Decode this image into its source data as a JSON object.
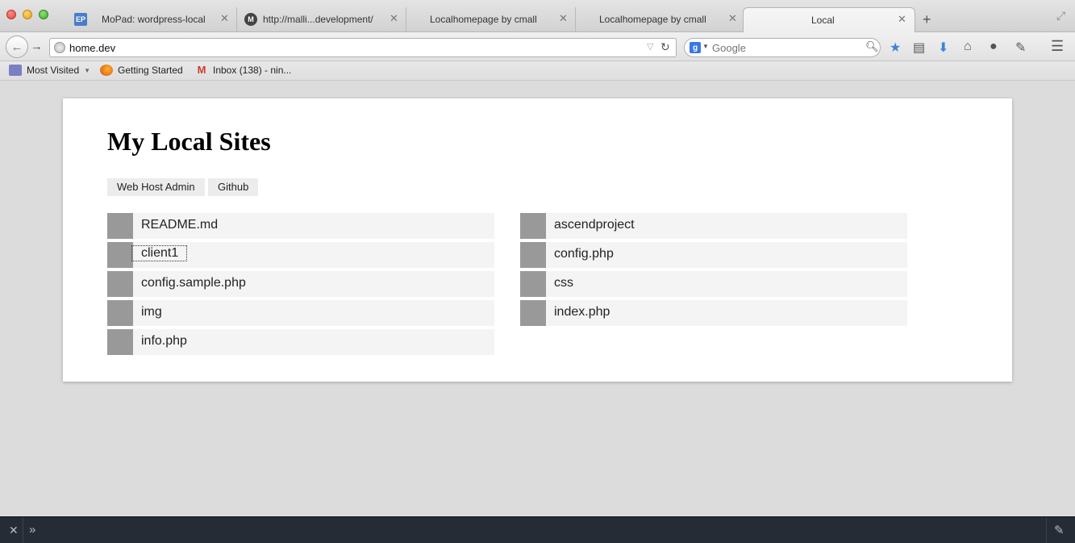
{
  "browser": {
    "tabs": [
      {
        "title": "MoPad: wordpress-local",
        "favicon": "EP",
        "close": "✕"
      },
      {
        "title": "http://malli...development/",
        "favicon": "M",
        "close": "✕"
      },
      {
        "title": "Localhomepage by cmall",
        "close": "✕"
      },
      {
        "title": "Localhomepage by cmall",
        "close": "✕"
      },
      {
        "title": "Local",
        "close": "✕",
        "active": true
      }
    ],
    "new_tab": "+",
    "url": "home.dev",
    "search_placeholder": "Google",
    "search_engine": "g"
  },
  "bookmarks": [
    {
      "label": "Most Visited",
      "icon": "most-visited-icon"
    },
    {
      "label": "Getting Started",
      "icon": "firefox-icon"
    },
    {
      "label": "Inbox (138) - nin...",
      "icon": "gmail-icon"
    }
  ],
  "page": {
    "title": "My Local Sites",
    "links": [
      "Web Host Admin",
      "Github"
    ],
    "sites_left": [
      "README.md",
      "client1",
      "config.sample.php",
      "img",
      "info.php"
    ],
    "sites_right": [
      "ascendproject",
      "config.php",
      "css",
      "index.php"
    ]
  },
  "colors": {
    "page_bg": "#dcdcdc",
    "row_bg": "#f4f4f4",
    "square": "#999999",
    "devtools_bg": "#252c35"
  }
}
